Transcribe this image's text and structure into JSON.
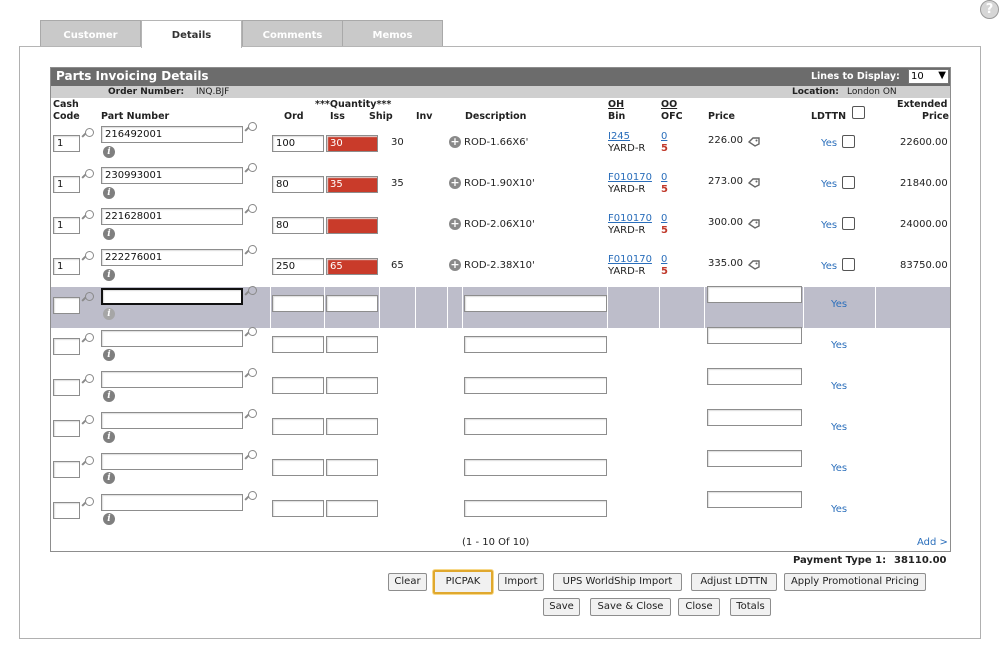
{
  "help_label": "?",
  "tabs": [
    "Customer",
    "Details",
    "Comments",
    "Memos"
  ],
  "active_tab": "Details",
  "grid": {
    "title": "Parts Invoicing Details",
    "lines_label": "Lines to Display:",
    "lines_value": "10",
    "order_label": "Order Number:",
    "order_value": "INQ.BJF",
    "location_label": "Location:",
    "location_value": "London ON"
  },
  "headers": {
    "cash_code_1": "Cash",
    "cash_code_2": "Code",
    "part_number": "Part Number",
    "quantity": "***Quantity***",
    "ord": "Ord",
    "iss": "Iss",
    "ship": "Ship",
    "inv": "Inv",
    "description": "Description",
    "oh": "OH",
    "bin": "Bin",
    "oo": "OO",
    "ofc": "OFC",
    "price": "Price",
    "ldttn": "LDTTN",
    "ext_1": "Extended",
    "ext_2": "Price"
  },
  "rows": [
    {
      "cash": "1",
      "part": "216492001",
      "ord": "100",
      "iss": "30",
      "ship": "30",
      "desc": "ROD-1.66X6'",
      "oh": "I245",
      "bin": "YARD-R",
      "oo": "0",
      "ofc": "5",
      "price": "226.00",
      "ldttn": "Yes",
      "ext": "22600.00"
    },
    {
      "cash": "1",
      "part": "230993001",
      "ord": "80",
      "iss": "35",
      "ship": "35",
      "desc": "ROD-1.90X10'",
      "oh": "F010170",
      "bin": "YARD-R",
      "oo": "0",
      "ofc": "5",
      "price": "273.00",
      "ldttn": "Yes",
      "ext": "21840.00"
    },
    {
      "cash": "1",
      "part": "221628001",
      "ord": "80",
      "iss": "",
      "ship": "",
      "desc": "ROD-2.06X10'",
      "oh": "F010170",
      "bin": "YARD-R",
      "oo": "0",
      "ofc": "5",
      "price": "300.00",
      "ldttn": "Yes",
      "ext": "24000.00"
    },
    {
      "cash": "1",
      "part": "222276001",
      "ord": "250",
      "iss": "65",
      "ship": "65",
      "desc": "ROD-2.38X10'",
      "oh": "F010170",
      "bin": "YARD-R",
      "oo": "0",
      "ofc": "5",
      "price": "335.00",
      "ldttn": "Yes",
      "ext": "83750.00"
    }
  ],
  "empty_rows_yes": [
    "Yes",
    "Yes",
    "Yes",
    "Yes",
    "Yes",
    "Yes"
  ],
  "pagination": "(1  - 10  Of 10)",
  "add_label": "Add >",
  "payment_label": "Payment Type 1:",
  "payment_value": "38110.00",
  "buttons_row1": [
    "Clear",
    "PICPAK",
    "Import",
    "UPS WorldShip Import",
    "Adjust LDTTN",
    "Apply Promotional Pricing"
  ],
  "buttons_row2": [
    "Save",
    "Save & Close",
    "Close",
    "Totals"
  ]
}
